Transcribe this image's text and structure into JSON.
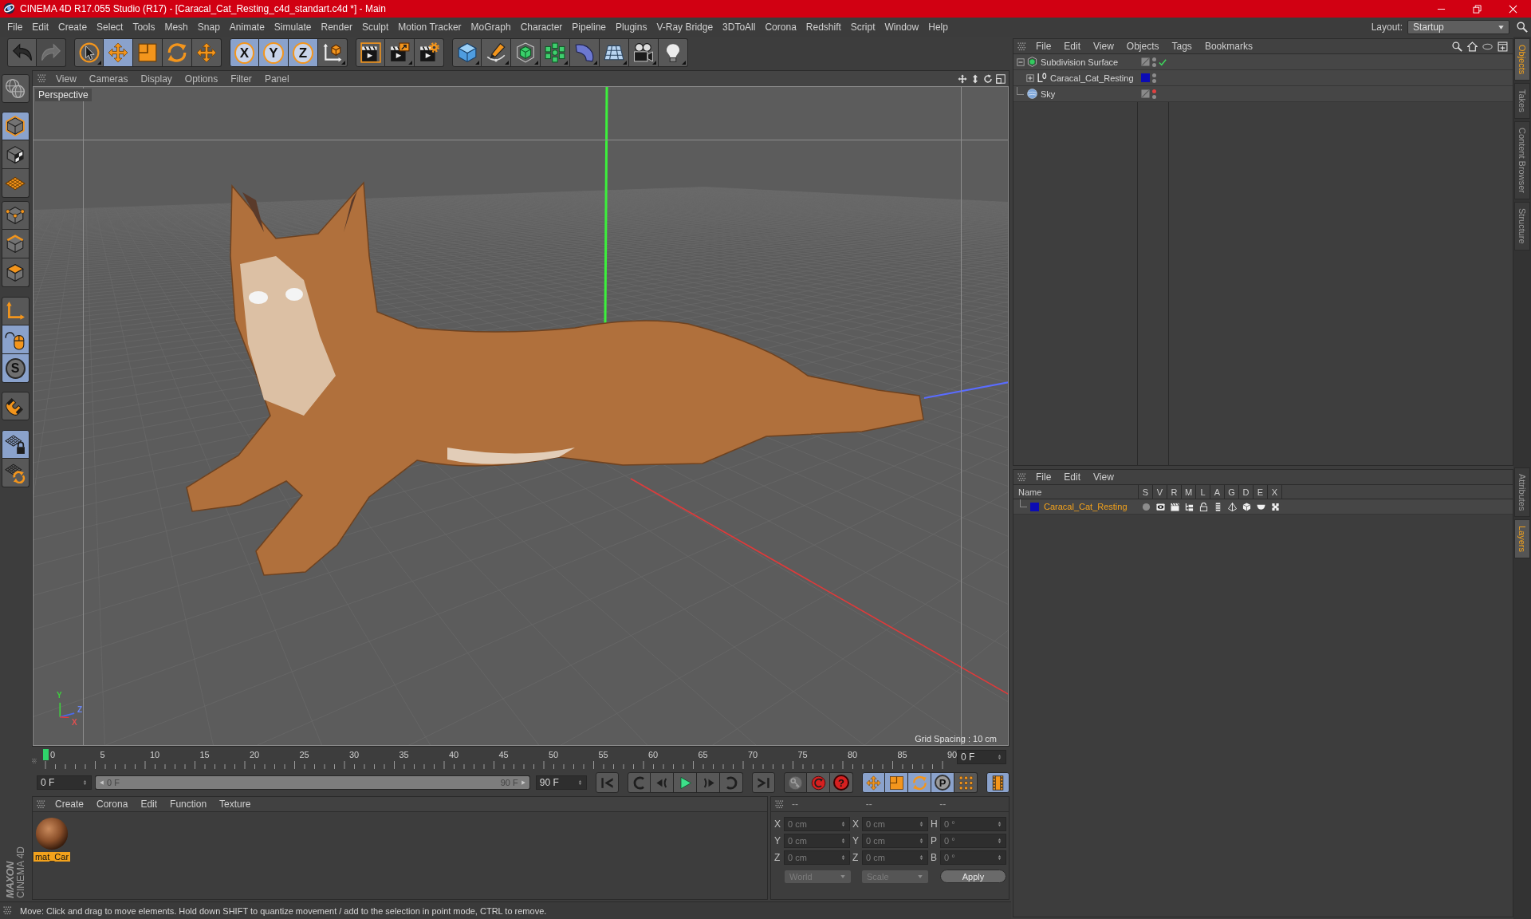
{
  "window": {
    "title": "CINEMA 4D R17.055 Studio (R17) - [Caracal_Cat_Resting_c4d_standart.c4d *] - Main"
  },
  "menu_bar": {
    "items": [
      "File",
      "Edit",
      "Create",
      "Select",
      "Tools",
      "Mesh",
      "Snap",
      "Animate",
      "Simulate",
      "Render",
      "Sculpt",
      "Motion Tracker",
      "MoGraph",
      "Character",
      "Pipeline",
      "Plugins",
      "V-Ray Bridge",
      "3DToAll",
      "Corona",
      "Redshift",
      "Script",
      "Window",
      "Help"
    ],
    "layout_label": "Layout:",
    "layout_value": "Startup"
  },
  "toolbar": {
    "history": [
      {
        "kind": "undo",
        "disabled": false
      },
      {
        "kind": "redo",
        "disabled": true
      }
    ],
    "tools": [
      {
        "kind": "select",
        "selected": false
      },
      {
        "kind": "move",
        "selected": true
      },
      {
        "kind": "scale",
        "selected": false
      },
      {
        "kind": "rotate",
        "selected": false
      },
      {
        "kind": "recent",
        "selected": false
      }
    ],
    "axes": [
      {
        "kind": "axis",
        "label": "X",
        "selected": true
      },
      {
        "kind": "axis",
        "label": "Y",
        "selected": true
      },
      {
        "kind": "axis",
        "label": "Z",
        "selected": true
      },
      {
        "kind": "coordinates",
        "selected": false
      }
    ],
    "render": [
      {
        "kind": "renderview"
      },
      {
        "kind": "renderpicture"
      },
      {
        "kind": "rendersettings"
      }
    ],
    "create": [
      {
        "kind": "cube"
      },
      {
        "kind": "pen"
      },
      {
        "kind": "subdivision"
      },
      {
        "kind": "cloner"
      },
      {
        "kind": "bend"
      },
      {
        "kind": "floor"
      },
      {
        "kind": "camera"
      },
      {
        "kind": "light"
      }
    ]
  },
  "mode_palette": [
    {
      "items": [
        {
          "kind": "editable",
          "selected": false
        }
      ]
    },
    {
      "items": [
        {
          "kind": "model",
          "selected": true
        },
        {
          "kind": "texture",
          "selected": false
        },
        {
          "kind": "workplane",
          "selected": false
        }
      ]
    },
    {
      "items": [
        {
          "kind": "points",
          "selected": false
        },
        {
          "kind": "edges",
          "selected": false
        },
        {
          "kind": "polygons",
          "selected": false
        }
      ]
    },
    {
      "items": [
        {
          "kind": "axis",
          "selected": false
        },
        {
          "kind": "tweak",
          "selected": true
        },
        {
          "kind": "snap",
          "label": "S",
          "selected": true
        }
      ]
    },
    {
      "items": [
        {
          "kind": "magnet",
          "selected": false
        }
      ]
    },
    {
      "items": [
        {
          "kind": "lock",
          "selected": true
        },
        {
          "kind": "planar",
          "selected": false
        }
      ]
    }
  ],
  "logo": {
    "brand": "MAXON",
    "product": "CINEMA 4D"
  },
  "viewport": {
    "menu": [
      "View",
      "Cameras",
      "Display",
      "Options",
      "Filter",
      "Panel"
    ],
    "camera_label": "Perspective",
    "grid_info": "Grid Spacing : 10 cm",
    "gizmo_labels": [
      "Y",
      "Z",
      "X"
    ]
  },
  "timeline": {
    "labels": [
      "0",
      "5",
      "10",
      "15",
      "20",
      "25",
      "30",
      "35",
      "40",
      "45",
      "50",
      "55",
      "60",
      "65",
      "70",
      "75",
      "80",
      "85",
      "90"
    ],
    "frame_field": "0 F",
    "playhead": {
      "level": 0
    }
  },
  "playback": {
    "start_field": "0 F",
    "range": {
      "start": "0 F",
      "end": "90 F",
      "level": 1
    },
    "end_field": "90 F",
    "transport": [
      {
        "kind": "first"
      },
      {
        "kind": "prevkey"
      },
      {
        "kind": "prevframe"
      },
      {
        "kind": "play"
      },
      {
        "kind": "nextframe"
      },
      {
        "kind": "nextkey"
      },
      {
        "kind": "last"
      }
    ],
    "record": [
      {
        "kind": "record",
        "disabled": true
      },
      {
        "kind": "autokey",
        "disabled": false
      },
      {
        "kind": "keyhelp",
        "label": "?",
        "disabled": false
      }
    ],
    "key_filters": [
      {
        "kind": "position",
        "selected": true
      },
      {
        "kind": "scale",
        "selected": true
      },
      {
        "kind": "rotation",
        "selected": true
      },
      {
        "kind": "parameter",
        "label": "P",
        "selected": true
      },
      {
        "kind": "points",
        "selected": false
      }
    ],
    "timeline_button": {
      "selected": true
    }
  },
  "material_manager": {
    "menu": [
      "Create",
      "Corona",
      "Edit",
      "Function",
      "Texture"
    ],
    "materials": [
      {
        "name": "mat_Car",
        "selected": true
      }
    ]
  },
  "coordinates": {
    "headers": [
      "--",
      "--",
      "--"
    ],
    "disabled": true,
    "rows": [
      {
        "cells": [
          {
            "axis": "X",
            "value": "0 cm"
          },
          {
            "axis": "X",
            "value": "0 cm"
          },
          {
            "axis": "H",
            "value": "0 °"
          }
        ]
      },
      {
        "cells": [
          {
            "axis": "Y",
            "value": "0 cm"
          },
          {
            "axis": "Y",
            "value": "0 cm"
          },
          {
            "axis": "P",
            "value": "0 °"
          }
        ]
      },
      {
        "cells": [
          {
            "axis": "Z",
            "value": "0 cm"
          },
          {
            "axis": "Z",
            "value": "0 cm"
          },
          {
            "axis": "B",
            "value": "0 °"
          }
        ]
      }
    ],
    "dropdowns": [
      "World",
      "Scale"
    ],
    "apply": "Apply"
  },
  "status_bar": {
    "text": "Move: Click and drag to move elements. Hold down SHIFT to quantize movement / add to the selection in point mode, CTRL to remove."
  },
  "object_manager": {
    "menu": [
      "File",
      "Edit",
      "View",
      "Objects",
      "Tags",
      "Bookmarks"
    ],
    "objects": [
      {
        "name": "Subdivision Surface",
        "kind": "subdivision",
        "expanded": true,
        "enabled": true,
        "editor_visible": true,
        "render_visible": true,
        "children": [
          {
            "name": "Caracal_Cat_Resting",
            "kind": "null",
            "expanded": false,
            "color": "#0c0cb4",
            "editor_visible": true,
            "render_visible": true
          }
        ]
      },
      {
        "name": "Sky",
        "kind": "sky",
        "editor_visible": false,
        "render_visible": true
      }
    ]
  },
  "layer_manager": {
    "menu": [
      "File",
      "Edit",
      "View"
    ],
    "columns": [
      "Name",
      "S",
      "V",
      "R",
      "M",
      "L",
      "A",
      "G",
      "D",
      "E",
      "X"
    ],
    "layers": [
      {
        "name": "Caracal_Cat_Resting",
        "color": "#0c0cb4",
        "selected": true,
        "switches": [
          {
            "on": false
          },
          {
            "on": true
          },
          {
            "on": true
          },
          {
            "on": true
          },
          {
            "on": false
          },
          {
            "on": true
          },
          {
            "on": true
          },
          {
            "on": true
          },
          {
            "on": true
          },
          {
            "on": true
          }
        ]
      }
    ]
  },
  "side_tabs": {
    "top": [
      {
        "label": "Objects",
        "selected": true
      },
      {
        "label": "Takes",
        "selected": false
      },
      {
        "label": "Content Browser",
        "selected": false
      },
      {
        "label": "Structure",
        "selected": false
      }
    ],
    "bottom": [
      {
        "label": "Attributes",
        "selected": false
      },
      {
        "label": "Layers",
        "selected": true
      }
    ]
  }
}
